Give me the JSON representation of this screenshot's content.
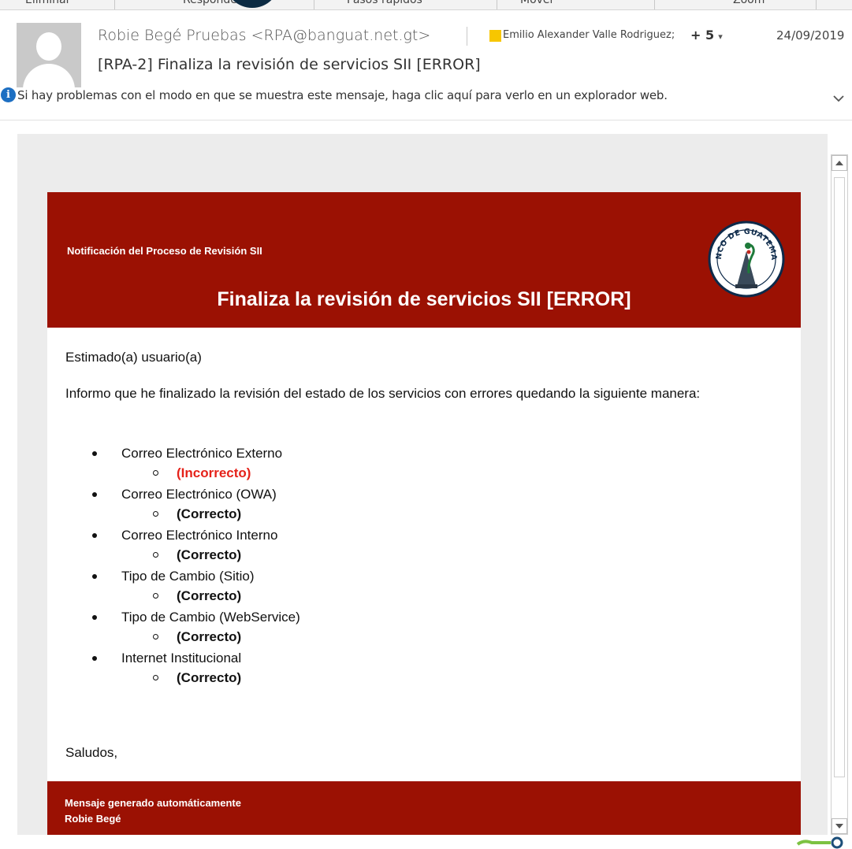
{
  "toolbar": {
    "items": [
      "Eliminar",
      "Responder",
      "Pasos rápidos",
      "Mover",
      "Zoom"
    ]
  },
  "header": {
    "sender": "Robie Begé Pruebas <RPA@banguat.net.gt>",
    "recipients": "Emilio Alexander Valle Rodriguez;",
    "more_recipients": "+ 5",
    "date": "24/09/2019",
    "subject": "[RPA-2] Finaliza la revisión de servicios SII [ERROR]",
    "category_color": "#f7c600"
  },
  "infobar": {
    "text": "Si hay problemas con el modo en que se muestra este mensaje, haga clic aquí para verlo en un explorador web."
  },
  "email": {
    "banner_label": "Notificación del Proceso de Revisión SII",
    "banner_title": "Finaliza la revisión de servicios SII [ERROR]",
    "banner_color": "#9b1103",
    "seal_text": "BANCO DE GUATEMALA",
    "greeting": "Estimado(a) usuario(a)",
    "intro": "Informo que he finalizado la revisión del estado de los servicios con errores quedando la siguiente manera:",
    "services": [
      {
        "name": "Correo Electrónico Externo",
        "status": "(Incorrecto)"
      },
      {
        "name": "Correo Electrónico (OWA)",
        "status": "(Correcto)"
      },
      {
        "name": "Correo Electrónico Interno",
        "status": "(Correcto)"
      },
      {
        "name": "Tipo de Cambio (Sitio)",
        "status": "(Correcto)"
      },
      {
        "name": "Tipo de Cambio (WebService)",
        "status": "(Correcto)"
      },
      {
        "name": "Internet Institucional",
        "status": "(Correcto)"
      }
    ],
    "closing": "Saludos,",
    "footer_line1": "Mensaje generado automáticamente",
    "footer_line2": "Robie Begé",
    "error_color": "#e5221a"
  }
}
